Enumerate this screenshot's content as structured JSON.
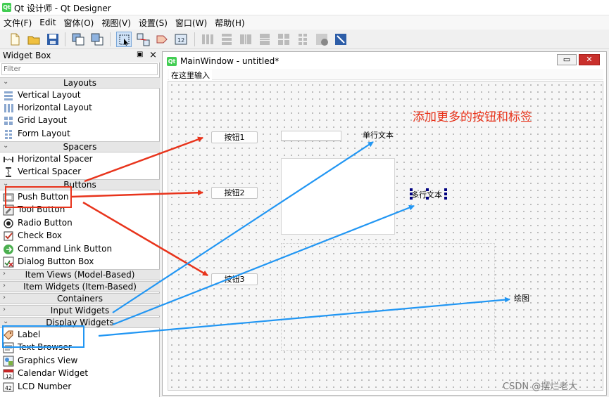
{
  "app": {
    "title": "Qt 设计师 - Qt Designer",
    "icon": "qt-logo-icon"
  },
  "menubar": {
    "items": [
      "文件(F)",
      "Edit",
      "窗体(O)",
      "视图(V)",
      "设置(S)",
      "窗口(W)",
      "帮助(H)"
    ]
  },
  "widget_box": {
    "title": "Widget Box",
    "filter_placeholder": "Filter",
    "categories": {
      "layouts": "Layouts",
      "spacers": "Spacers",
      "buttons": "Buttons",
      "item_views": "Item Views (Model-Based)",
      "item_widgets": "Item Widgets (Item-Based)",
      "containers": "Containers",
      "input_widgets": "Input Widgets",
      "display_widgets": "Display Widgets"
    },
    "items": {
      "vertical_layout": "Vertical Layout",
      "horizontal_layout": "Horizontal Layout",
      "grid_layout": "Grid Layout",
      "form_layout": "Form Layout",
      "horizontal_spacer": "Horizontal Spacer",
      "vertical_spacer": "Vertical Spacer",
      "push_button": "Push Button",
      "tool_button": "Tool Button",
      "radio_button": "Radio Button",
      "check_box": "Check Box",
      "command_link_button": "Command Link Button",
      "dialog_button_box": "Dialog Button Box",
      "label": "Label",
      "text_browser": "Text Browser",
      "graphics_view": "Graphics View",
      "calendar_widget": "Calendar Widget",
      "lcd_number": "LCD Number"
    }
  },
  "main_window": {
    "title": "MainWindow - untitled*",
    "menu_placeholder": "在这里输入",
    "buttons": [
      "按钮1",
      "按钮2",
      "按钮3"
    ],
    "labels": {
      "line_edit": "单行文本",
      "text_edit": "多行文本",
      "drawing": "绘图"
    },
    "annotation": "添加更多的按钮和标签"
  },
  "colors": {
    "accent_red": "#e8341c",
    "accent_blue": "#2196f3",
    "qt_green": "#41cd52"
  },
  "watermark": "CSDN @摆烂老大"
}
